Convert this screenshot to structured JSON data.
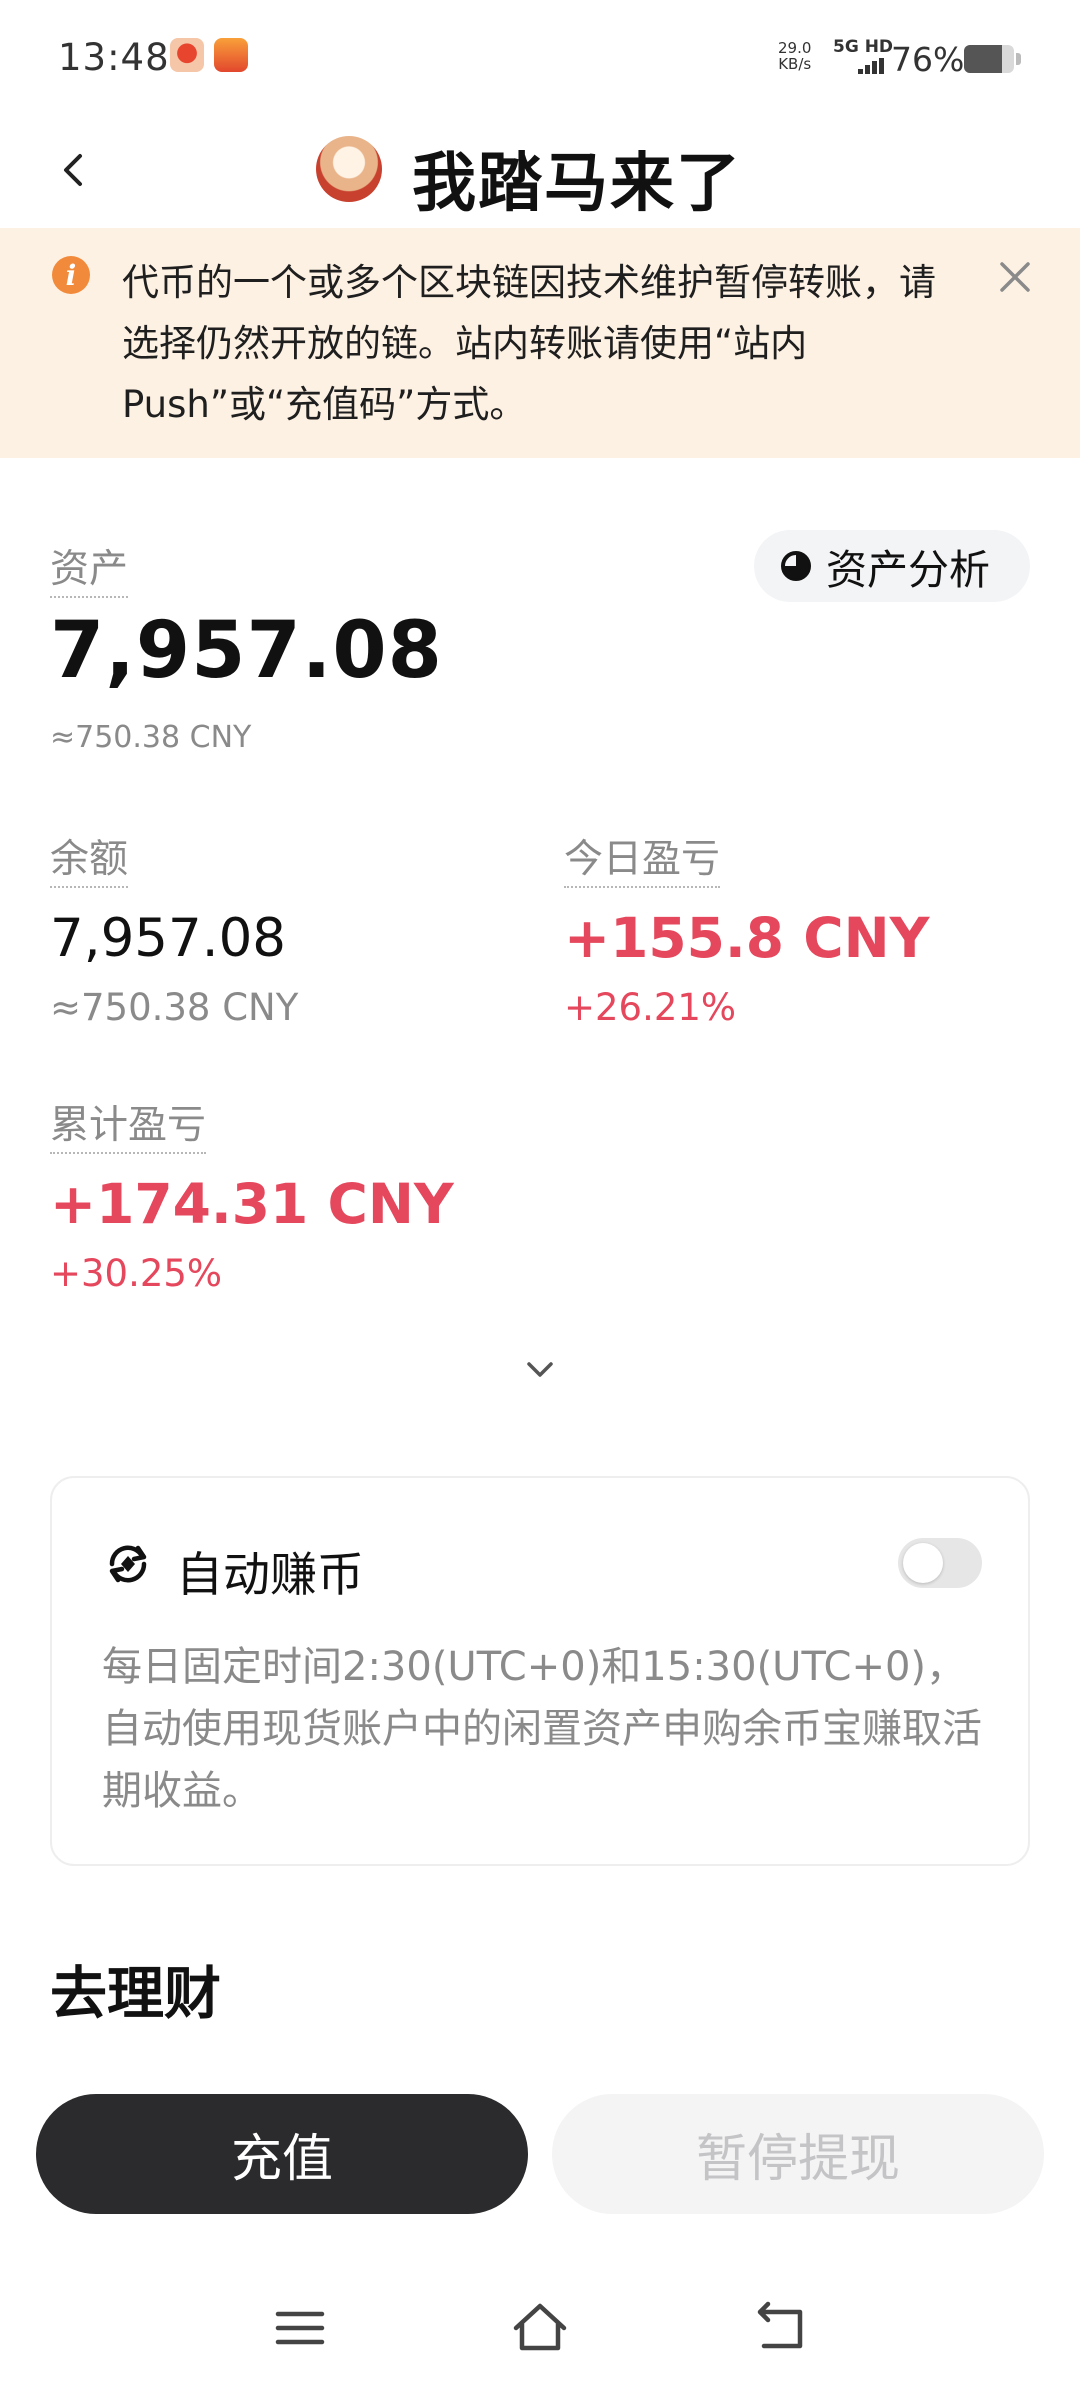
{
  "status_bar": {
    "time": "13:48",
    "net_speed_value": "29.0",
    "net_speed_unit": "KB/s",
    "network_type": "5G HD",
    "battery_percent": "76%",
    "battery_level": 0.76
  },
  "header": {
    "title": "我踏马来了",
    "back_icon": "chevron-left-icon",
    "avatar_icon": "avatar-icon"
  },
  "notice": {
    "icon": "info-icon",
    "text": "代币的一个或多个区块链因技术维护暂停转账，请选择仍然开放的链。站内转账请使用“站内Push”或“充值码”方式。",
    "close_icon": "close-icon",
    "accent_color": "#f28a3b",
    "background_color": "#fdf1e3"
  },
  "assets": {
    "label": "资产",
    "value": "7,957.08",
    "cny": "≈750.38 CNY",
    "analysis_button": "资产分析",
    "analysis_icon": "pie-chart-icon"
  },
  "balance": {
    "label": "余额",
    "value": "7,957.08",
    "cny": "≈750.38 CNY"
  },
  "today_pnl": {
    "label": "今日盈亏",
    "value": "+155.8 CNY",
    "percent": "+26.21%",
    "color": "#e5475c"
  },
  "total_pnl": {
    "label": "累计盈亏",
    "value": "+174.31 CNY",
    "percent": "+30.25%",
    "color": "#e5475c"
  },
  "expand_icon": "chevron-down-icon",
  "auto_earn": {
    "icon": "auto-sync-icon",
    "title": "自动赚币",
    "enabled": false,
    "description": "每日固定时间2:30(UTC+0)和15:30(UTC+0)，自动使用现货账户中的闲置资产申购余币宝赚取活期收益。"
  },
  "section": {
    "title": "去理财"
  },
  "actions": {
    "deposit": "充值",
    "withdraw": "暂停提现",
    "primary_color": "#2b2b2d"
  },
  "nav_bar": {
    "menu_icon": "menu-icon",
    "home_icon": "home-icon",
    "back_icon": "back-icon"
  }
}
